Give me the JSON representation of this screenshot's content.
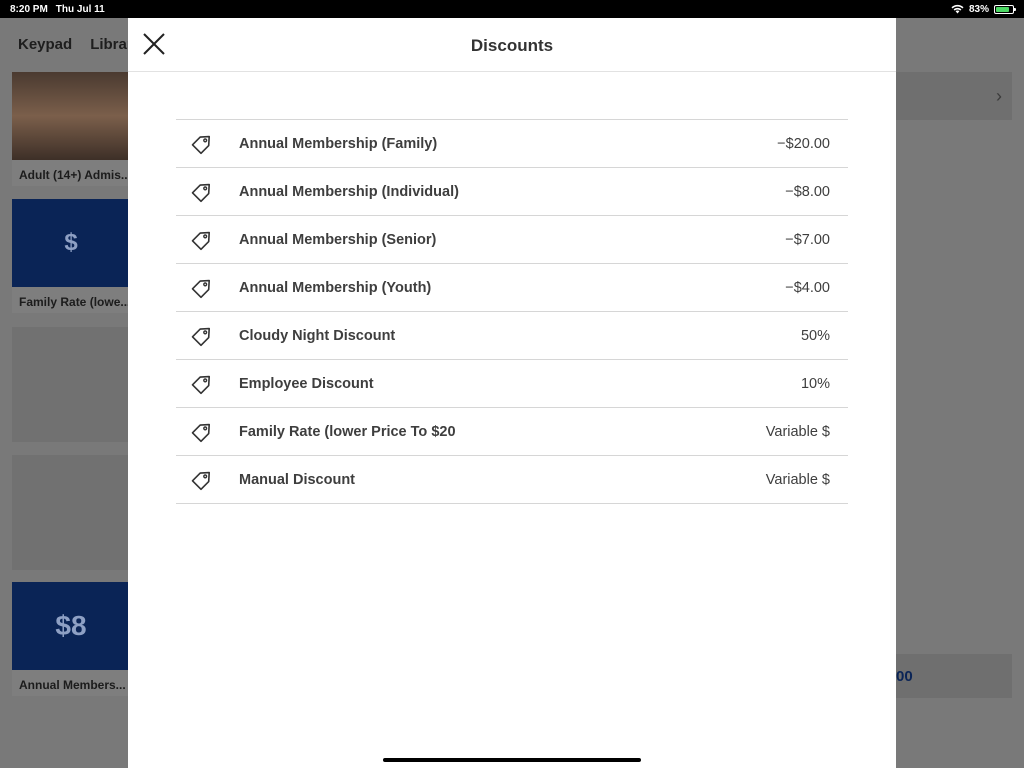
{
  "status_bar": {
    "time": "8:20 PM",
    "date": "Thu Jul 11",
    "battery": "83%"
  },
  "background": {
    "tabs": [
      "Keypad",
      "Library"
    ],
    "tiles": [
      {
        "caption": "Adult (14+) Admis...",
        "label": ""
      },
      {
        "caption": "Family Rate (lowe...",
        "label": "$"
      },
      {
        "caption": "Annual Members...",
        "label": "$8"
      }
    ],
    "right_button_text": "00"
  },
  "modal": {
    "title": "Discounts",
    "discounts": [
      {
        "name": "Annual Membership (Family)",
        "amount": "−$20.00"
      },
      {
        "name": "Annual Membership (Individual)",
        "amount": "−$8.00"
      },
      {
        "name": "Annual Membership (Senior)",
        "amount": "−$7.00"
      },
      {
        "name": "Annual Membership (Youth)",
        "amount": "−$4.00"
      },
      {
        "name": "Cloudy Night Discount",
        "amount": "50%"
      },
      {
        "name": "Employee Discount",
        "amount": "10%"
      },
      {
        "name": "Family Rate (lower Price To $20",
        "amount": "Variable $"
      },
      {
        "name": "Manual Discount",
        "amount": "Variable $"
      }
    ]
  },
  "colors": {
    "accent_blue": "#0a2456",
    "text": "#3e3e3e",
    "divider": "#d6d6d6"
  }
}
